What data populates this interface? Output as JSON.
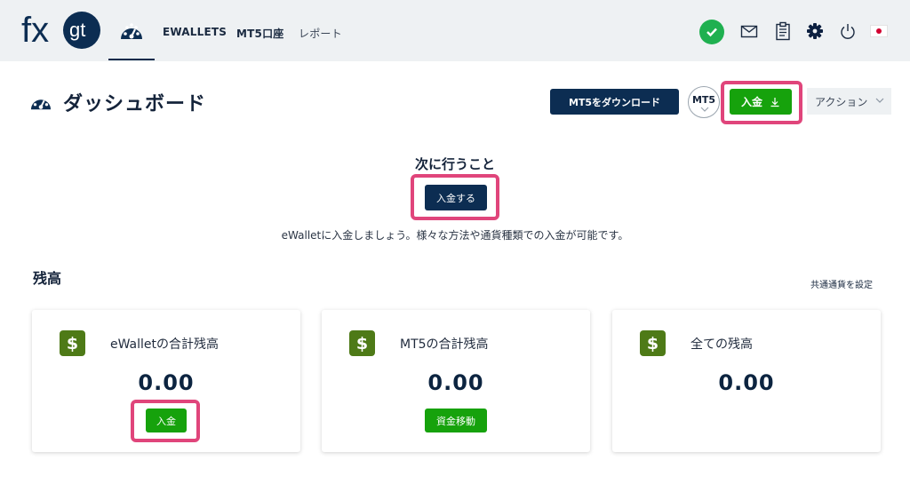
{
  "nav": {
    "logo_text_fx": "fx",
    "logo_text_gt": "gt",
    "ewallets": "EWALLETS",
    "mt5_accounts": "MT5口座",
    "reports": "レポート"
  },
  "header": {
    "title": "ダッシュボード",
    "download_mt5": "MT5をダウンロード",
    "mt5_badge": "MT5",
    "deposit": "入金",
    "actions": "アクション"
  },
  "next_step": {
    "heading": "次に行うこと",
    "button": "入金する",
    "description": "eWalletに入金しましょう。様々な方法や通貨種類での入金が可能です。"
  },
  "balances": {
    "title": "残高",
    "set_currency": "共通通貨を設定",
    "cards": [
      {
        "label": "eWalletの合計残高",
        "amount": "0.00",
        "button": "入金"
      },
      {
        "label": "MT5の合計残高",
        "amount": "0.00",
        "button": "資金移動"
      },
      {
        "label": "全ての残高",
        "amount": "0.00"
      }
    ]
  },
  "icons": {
    "currency_symbol": "$"
  },
  "colors": {
    "navy": "#0c2d52",
    "green": "#16a20c",
    "highlight": "#e0457b",
    "card_icon": "#4e7a17",
    "verified": "#1fb050"
  }
}
